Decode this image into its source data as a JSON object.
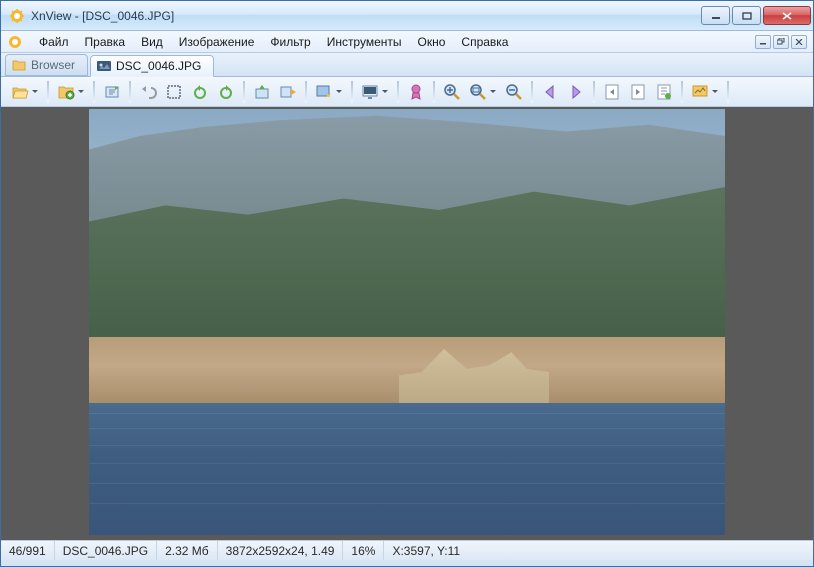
{
  "window": {
    "title": "XnView - [DSC_0046.JPG]"
  },
  "menu": {
    "file": "Файл",
    "edit": "Правка",
    "view": "Вид",
    "image": "Изображение",
    "filter": "Фильтр",
    "tools": "Инструменты",
    "window": "Окно",
    "help": "Справка"
  },
  "tabs": {
    "browser": {
      "label": "Browser"
    },
    "current": {
      "label": "DSC_0046.JPG"
    }
  },
  "status": {
    "index": "46/991",
    "filename": "DSC_0046.JPG",
    "size": "2.32 Мб",
    "dims": "3872x2592x24, 1.49",
    "zoom": "16%",
    "coords": "X:3597, Y:11"
  }
}
